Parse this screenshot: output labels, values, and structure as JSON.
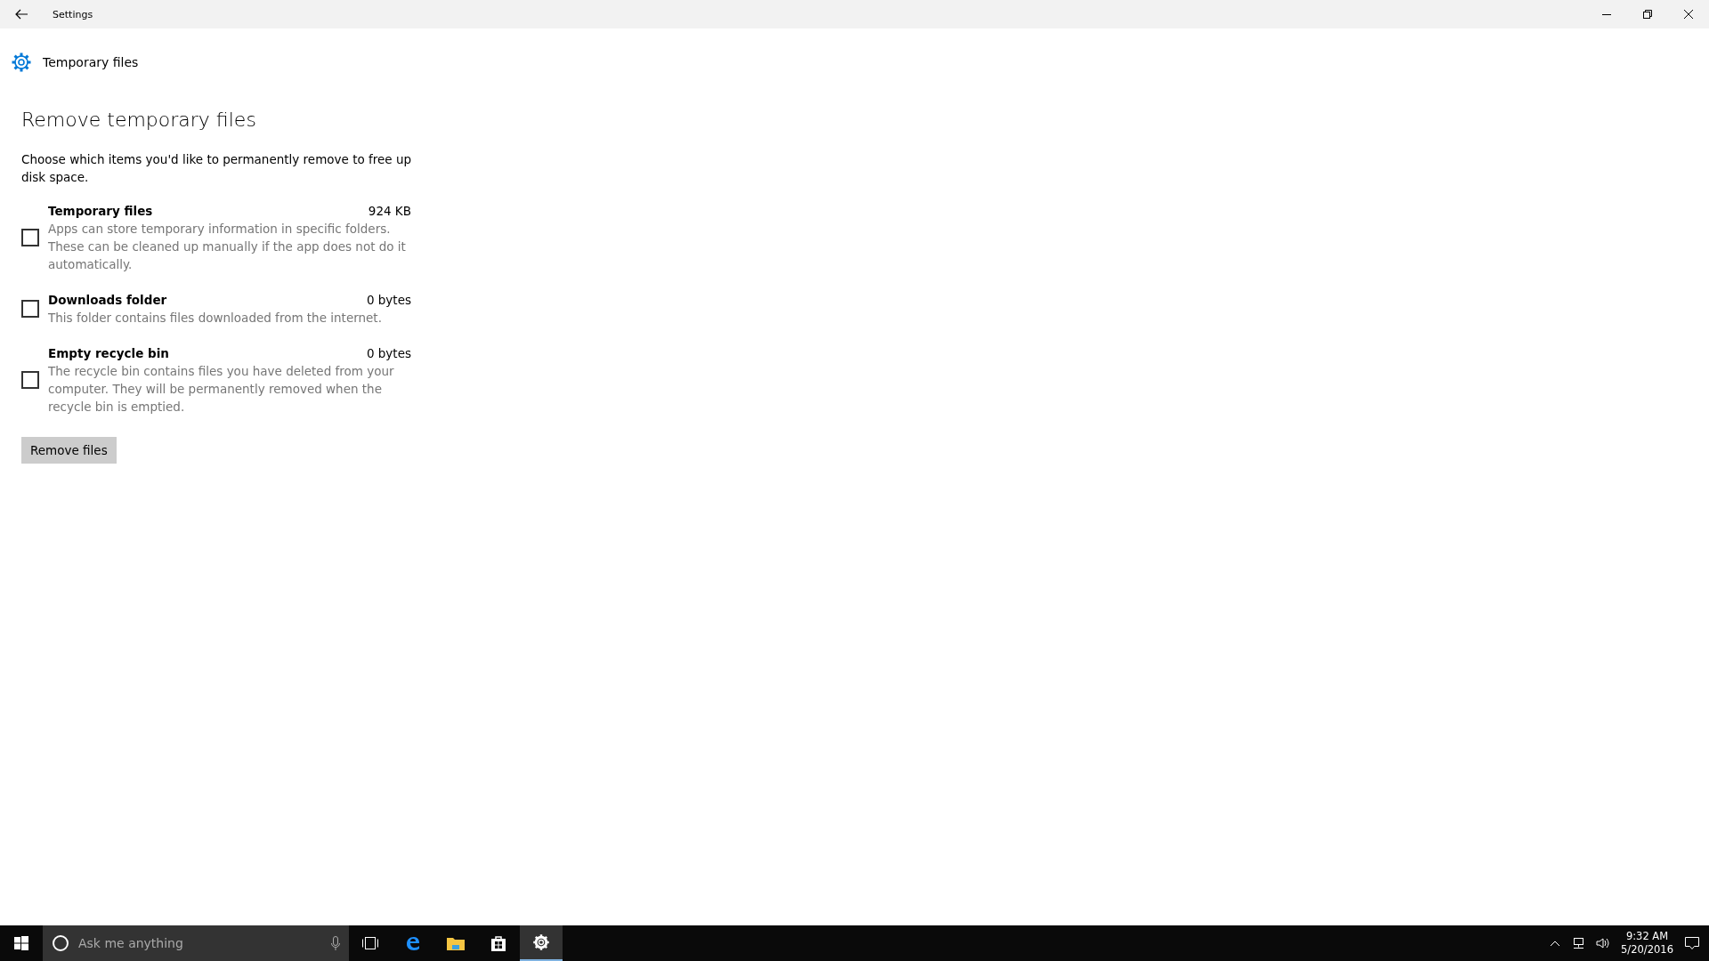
{
  "window": {
    "title": "Settings"
  },
  "page_header": {
    "title": "Temporary files"
  },
  "section": {
    "heading": "Remove temporary files",
    "description": "Choose which items you'd like to permanently remove to free up disk space."
  },
  "items": [
    {
      "name": "Temporary files",
      "size": "924 KB",
      "description": "Apps can store temporary information in specific folders. These can be cleaned up manually if the app does not do it automatically.",
      "checked": false
    },
    {
      "name": "Downloads folder",
      "size": "0 bytes",
      "description": "This folder contains files downloaded from the internet.",
      "checked": false
    },
    {
      "name": "Empty recycle bin",
      "size": "0 bytes",
      "description": "The recycle bin contains files you have deleted from your computer. They will be permanently removed when the recycle bin is emptied.",
      "checked": false
    }
  ],
  "button": "Remove files",
  "taskbar": {
    "search_placeholder": "Ask me anything",
    "time": "9:32 AM",
    "date": "5/20/2016",
    "apps": [
      {
        "kind": "edge",
        "selected": false
      },
      {
        "kind": "explorer",
        "selected": false
      },
      {
        "kind": "store",
        "selected": false
      },
      {
        "kind": "settings",
        "selected": true
      }
    ]
  }
}
